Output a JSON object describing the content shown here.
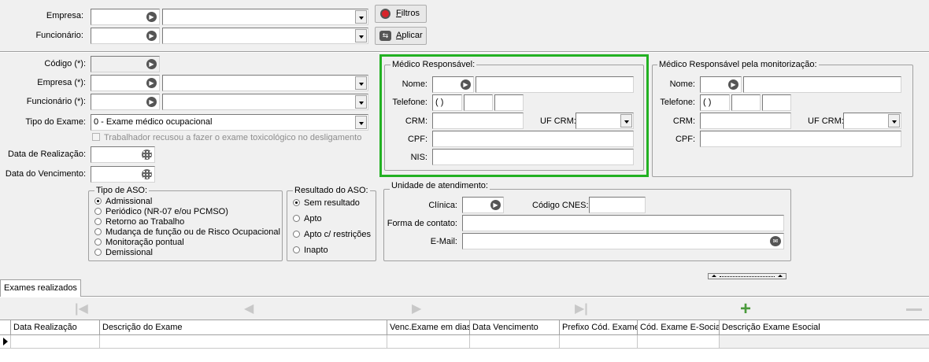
{
  "filter": {
    "empresa_label": "Empresa:",
    "funcionario_label": "Funcionário:",
    "filtros_prefix": "F",
    "filtros_rest": "iltros",
    "aplicar_prefix": "A",
    "aplicar_rest": "plicar"
  },
  "form": {
    "codigo_label": "Código (*):",
    "empresa_label": "Empresa (*):",
    "funcionario_label": "Funcionário (*):",
    "tipo_exame_label": "Tipo do Exame:",
    "tipo_exame_value": "0 - Exame médico ocupacional",
    "toxico_label": "Trabalhador recusou a fazer o exame toxicológico no desligamento",
    "data_realizacao_label": "Data de Realização:",
    "data_vencimento_label": "Data do Vencimento:"
  },
  "medico": {
    "title": "Médico Responsável:",
    "nome_label": "Nome:",
    "telefone_label": "Telefone:",
    "telefone_value": "(   )",
    "crm_label": "CRM:",
    "uf_crm_label": "UF CRM:",
    "cpf_label": "CPF:",
    "nis_label": "NIS:"
  },
  "medico_monit": {
    "title": "Médico Responsável pela monitorização:",
    "nome_label": "Nome:",
    "telefone_label": "Telefone:",
    "telefone_value": "(   )",
    "crm_label": "CRM:",
    "uf_crm_label": "UF CRM:",
    "cpf_label": "CPF:"
  },
  "aso": {
    "title": "Tipo de ASO:",
    "options": [
      "Admissional",
      "Periódico (NR-07 e/ou PCMSO)",
      "Retorno ao Trabalho",
      "Mudança de função ou de Risco Ocupacional",
      "Monitoração pontual",
      "Demissional"
    ]
  },
  "resultado": {
    "title": "Resultado do ASO:",
    "options": [
      "Sem resultado",
      "Apto",
      "Apto c/ restrições",
      "Inapto"
    ]
  },
  "unidade": {
    "title": "Unidade de atendimento:",
    "clinica_label": "Clínica:",
    "cnes_label": "Código CNES:",
    "contato_label": "Forma de contato:",
    "email_label": "E-Mail:"
  },
  "tabs": {
    "exames": "Exames realizados"
  },
  "grid": {
    "columns": [
      "Data Realização",
      "Descrição do Exame",
      "Venc.Exame em dias",
      "Data Vencimento",
      "Prefixo Cód. Exame",
      "Cód. Exame E-Social",
      "Descrição Exame Esocial"
    ]
  },
  "colors": {
    "highlight": "#22b122",
    "background": "#f0f0f0"
  }
}
